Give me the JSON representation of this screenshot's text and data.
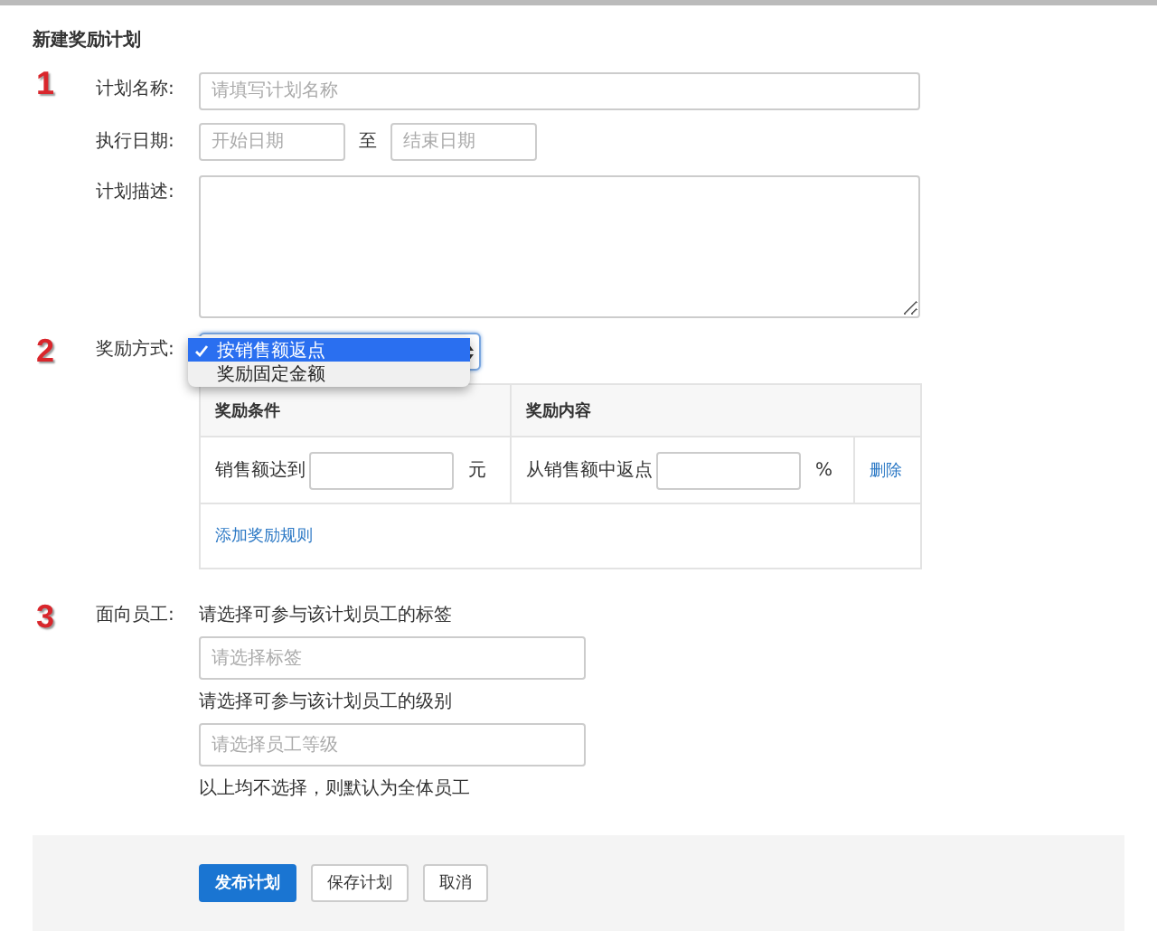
{
  "page_title": "新建奖励计划",
  "plan_name": {
    "step": "1",
    "label": "计划名称:",
    "placeholder": "请填写计划名称"
  },
  "period": {
    "label": "执行日期:",
    "start_placeholder": "开始日期",
    "separator": "至",
    "end_placeholder": "结束日期"
  },
  "description": {
    "label": "计划描述:"
  },
  "reward_method": {
    "step": "2",
    "label": "奖励方式:",
    "options": [
      {
        "label": "按销售额返点",
        "selected": true
      },
      {
        "label": "奖励固定金额",
        "selected": false
      }
    ]
  },
  "reward_table": {
    "columns": [
      "奖励条件",
      "奖励内容"
    ],
    "rows": [
      {
        "condition_label": "销售额达到",
        "condition_unit": "元",
        "content_label": "从销售额中返点",
        "content_unit": "%",
        "action": "删除"
      }
    ],
    "add_link": "添加奖励规则"
  },
  "employees": {
    "step": "3",
    "label": "面向员工:",
    "tag_prompt": "请选择可参与该计划员工的标签",
    "tag_placeholder": "请选择标签",
    "level_prompt": "请选择可参与该计划员工的级别",
    "level_placeholder": "请选择员工等级",
    "note": "以上均不选择，则默认为全体员工"
  },
  "buttons": [
    {
      "label": "发布计划",
      "kind": "primary"
    },
    {
      "label": "保存计划",
      "kind": "default"
    },
    {
      "label": "取消",
      "kind": "default"
    }
  ]
}
